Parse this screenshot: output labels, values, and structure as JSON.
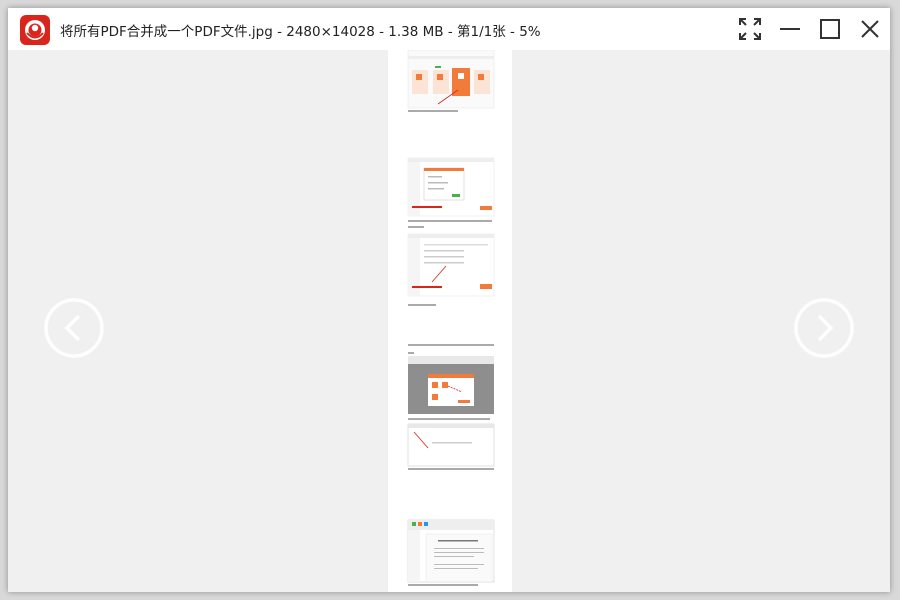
{
  "window": {
    "title": "将所有PDF合并成一个PDF文件.jpg - 2480×14028 - 1.38 MB - 第1/1张 - 5%"
  },
  "titlebar_buttons": {
    "fullscreen": "fullscreen-icon",
    "minimize": "minimize-icon",
    "maximize": "maximize-icon",
    "close": "close-icon"
  },
  "viewer": {
    "prev_icon": "chevron-left-icon",
    "next_icon": "chevron-right-icon"
  },
  "colors": {
    "accent": "#d9261c",
    "viewer_background": "#f0f0f0",
    "screenshot_orange": "#f27a3a"
  }
}
